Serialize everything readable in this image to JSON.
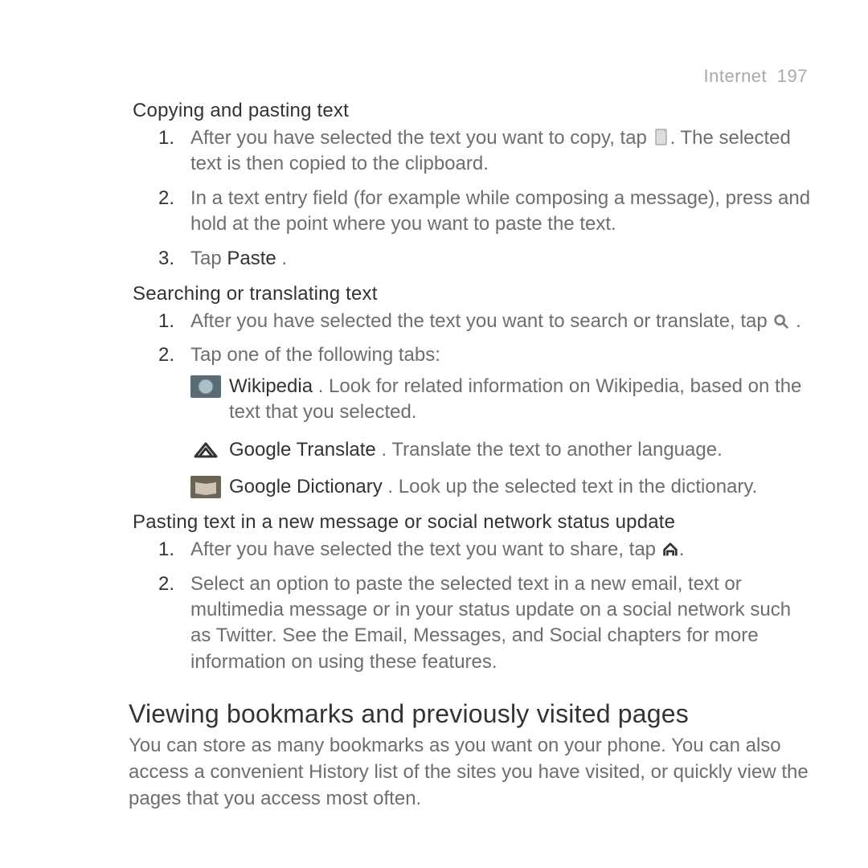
{
  "header": {
    "chapter": "Internet",
    "page": "197"
  },
  "section1": {
    "heading": "Copying and pasting text",
    "steps": {
      "s1a": "After you have selected the text you want to copy, tap ",
      "s1b": ". The selected text is then copied to the clipboard.",
      "s2": "In a text entry field (for example while composing a message), press and hold at the point where you want to paste the text.",
      "s3a": "Tap ",
      "s3b": "Paste",
      "s3c": " ."
    }
  },
  "section2": {
    "heading": "Searching or translating text",
    "steps": {
      "s1a": "After you have selected the text you want to search or translate, tap ",
      "s1b": " .",
      "s2": "Tap one of the following tabs:"
    },
    "tabs": {
      "wiki": {
        "label": "Wikipedia",
        "desc": " . Look for related information on Wikipedia, based on the text that you selected."
      },
      "translate": {
        "label": "Google Translate",
        "desc": " . Translate the text to another language."
      },
      "dict": {
        "label": "Google Dictionary",
        "desc": " . Look up the selected text in the dictionary."
      }
    }
  },
  "section3": {
    "heading": "Pasting text in a new message or social network status update",
    "steps": {
      "s1a": "After you have selected the text you want to share, tap ",
      "s1b": ".",
      "s2": "Select an option to paste the selected text in a new email, text or multimedia message or in your status update on a social network such as Twitter. See the Email, Messages, and Social chapters for more information on using these features."
    }
  },
  "viewing": {
    "heading": "Viewing  bookmarks and previously visited pages",
    "body": "You can store as many bookmarks as you want on your phone. You can also access a convenient History list of the sites you have visited, or quickly view the pages that you access most often."
  }
}
